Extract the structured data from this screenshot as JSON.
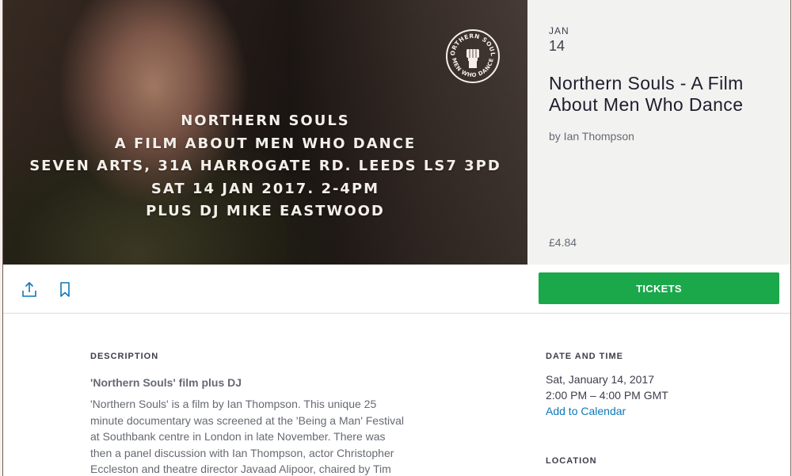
{
  "hero": {
    "lines": [
      "NORTHERN SOULS",
      "A FILM ABOUT MEN WHO DANCE",
      "SEVEN ARTS, 31A HARROGATE RD. LEEDS LS7 3PD",
      "SAT 14 JAN 2017. 2-4PM",
      "PLUS DJ MIKE EASTWOOD"
    ],
    "logo_top_text": "NORTHERN SOULS",
    "logo_bottom_text": "MEN WHO DANCE"
  },
  "summary": {
    "month": "JAN",
    "day": "14",
    "title": "Northern Souls - A Film About Men Who Dance",
    "organizer": "by Ian Thompson",
    "price": "£4.84"
  },
  "actions": {
    "share_icon": "share-upload-icon",
    "bookmark_icon": "bookmark-icon",
    "tickets_label": "TICKETS"
  },
  "description": {
    "heading": "DESCRIPTION",
    "subtitle": "'Northern Souls' film plus DJ",
    "body_lines": [
      "'Northern Souls' is a film by Ian Thompson. This unique 25",
      "minute documentary was screened at the 'Being a Man' Festival",
      "at Southbank centre in London in late November. There was",
      "then a panel discussion with Ian Thompson, actor Christopher",
      "Eccleston and theatre director Javaad Alipoor, chaired by Tim"
    ]
  },
  "date_time": {
    "heading": "DATE AND TIME",
    "date": "Sat, January 14, 2017",
    "time": "2:00 PM – 4:00 PM GMT",
    "add_to_calendar": "Add to Calendar"
  },
  "location": {
    "heading": "LOCATION"
  },
  "colors": {
    "accent_green": "#1aa84b",
    "link_blue": "#0f77b8",
    "summary_bg": "#f2f2f1"
  }
}
